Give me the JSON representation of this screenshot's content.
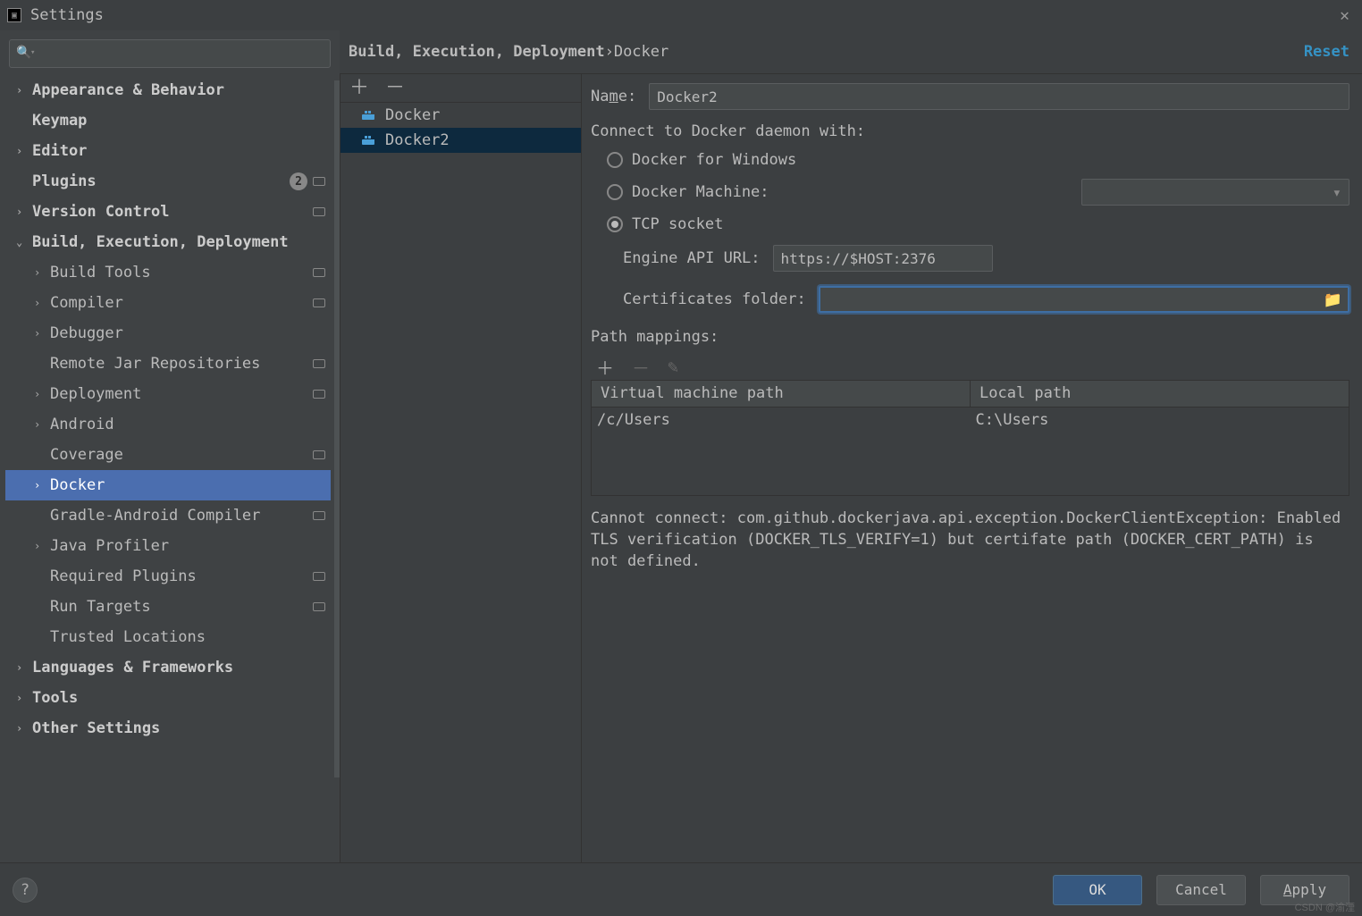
{
  "window": {
    "title": "Settings"
  },
  "search": {
    "placeholder": ""
  },
  "tree": [
    {
      "label": "Appearance & Behavior",
      "bold": true,
      "chev": "›",
      "level": 0
    },
    {
      "label": "Keymap",
      "bold": true,
      "chev": "",
      "level": 0
    },
    {
      "label": "Editor",
      "bold": true,
      "chev": "›",
      "level": 0
    },
    {
      "label": "Plugins",
      "bold": true,
      "chev": "",
      "level": 0,
      "badge": "2",
      "mod": true
    },
    {
      "label": "Version Control",
      "bold": true,
      "chev": "›",
      "level": 0,
      "mod": true
    },
    {
      "label": "Build, Execution, Deployment",
      "bold": true,
      "chev": "⌄",
      "level": 0
    },
    {
      "label": "Build Tools",
      "bold": false,
      "chev": "›",
      "level": 1,
      "mod": true
    },
    {
      "label": "Compiler",
      "bold": false,
      "chev": "›",
      "level": 1,
      "mod": true
    },
    {
      "label": "Debugger",
      "bold": false,
      "chev": "›",
      "level": 1
    },
    {
      "label": "Remote Jar Repositories",
      "bold": false,
      "chev": "",
      "level": 1,
      "mod": true
    },
    {
      "label": "Deployment",
      "bold": false,
      "chev": "›",
      "level": 1,
      "mod": true
    },
    {
      "label": "Android",
      "bold": false,
      "chev": "›",
      "level": 1
    },
    {
      "label": "Coverage",
      "bold": false,
      "chev": "",
      "level": 1,
      "mod": true
    },
    {
      "label": "Docker",
      "bold": false,
      "chev": "›",
      "level": 1,
      "selected": true
    },
    {
      "label": "Gradle-Android Compiler",
      "bold": false,
      "chev": "",
      "level": 1,
      "mod": true
    },
    {
      "label": "Java Profiler",
      "bold": false,
      "chev": "›",
      "level": 1
    },
    {
      "label": "Required Plugins",
      "bold": false,
      "chev": "",
      "level": 1,
      "mod": true
    },
    {
      "label": "Run Targets",
      "bold": false,
      "chev": "",
      "level": 1,
      "mod": true
    },
    {
      "label": "Trusted Locations",
      "bold": false,
      "chev": "",
      "level": 1
    },
    {
      "label": "Languages & Frameworks",
      "bold": true,
      "chev": "›",
      "level": 0
    },
    {
      "label": "Tools",
      "bold": true,
      "chev": "›",
      "level": 0
    },
    {
      "label": "Other Settings",
      "bold": true,
      "chev": "›",
      "level": 0
    }
  ],
  "breadcrumb": {
    "a": "Build, Execution, Deployment",
    "b": "Docker",
    "reset": "Reset"
  },
  "configs": [
    {
      "label": "Docker",
      "selected": false
    },
    {
      "label": "Docker2",
      "selected": true
    }
  ],
  "form": {
    "name_label_prefix": "Na",
    "name_label_u": "m",
    "name_label_suffix": "e:",
    "name_value": "Docker2",
    "connect_label": "Connect to Docker daemon with:",
    "opt_windows": "Docker for Windows",
    "opt_machine": "Docker Machine:",
    "opt_tcp": "TCP socket",
    "engine_label": "Engine API URL:",
    "engine_value": "https://$HOST:2376",
    "certs_label": "Certificates folder:",
    "certs_value": "",
    "path_label": "Path mappings:",
    "path_cols": {
      "a": "Virtual machine path",
      "b": "Local path"
    },
    "path_rows": [
      {
        "a": "/c/Users",
        "b": "C:\\Users"
      }
    ],
    "error": "Cannot connect: com.github.dockerjava.api.exception.DockerClientException: Enabled TLS verification (DOCKER_TLS_VERIFY=1) but certifate path (DOCKER_CERT_PATH) is not defined."
  },
  "footer": {
    "ok": "OK",
    "cancel": "Cancel",
    "apply_u": "A",
    "apply_rest": "pply"
  },
  "watermark": "CSDN @渝湮"
}
